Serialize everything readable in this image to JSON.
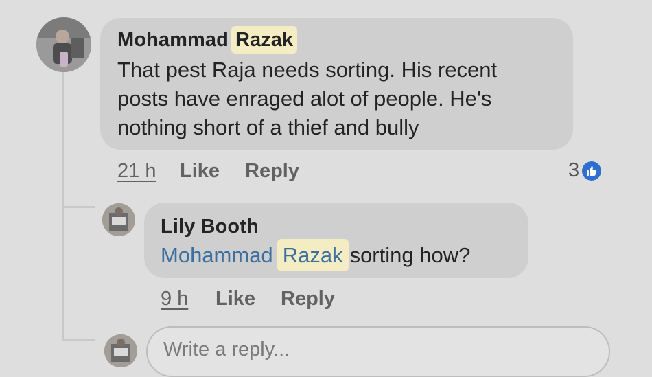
{
  "comments": [
    {
      "author_first": "Mohammad",
      "author_highlight": "Razak",
      "text_lines": [
        "That pest Raja needs sorting. His recent",
        "posts have enraged alot of people. He's",
        "nothing short of a thief and bully"
      ],
      "time": "21 h",
      "like_label": "Like",
      "reply_label": "Reply",
      "reaction_count": "3",
      "reaction_icon": "thumbs-up-icon"
    }
  ],
  "reply": {
    "author": "Lily Booth",
    "mention_first": "Mohammad",
    "mention_highlight": "Razak",
    "text": "sorting how?",
    "time": "9 h",
    "like_label": "Like",
    "reply_label": "Reply"
  },
  "composer": {
    "placeholder": "Write a reply..."
  },
  "colors": {
    "background": "#dedede",
    "bubble": "#cfcfcf",
    "highlight": "#f4ecc3",
    "mention": "#3c6f9f",
    "like_badge": "#2e6ecf"
  }
}
